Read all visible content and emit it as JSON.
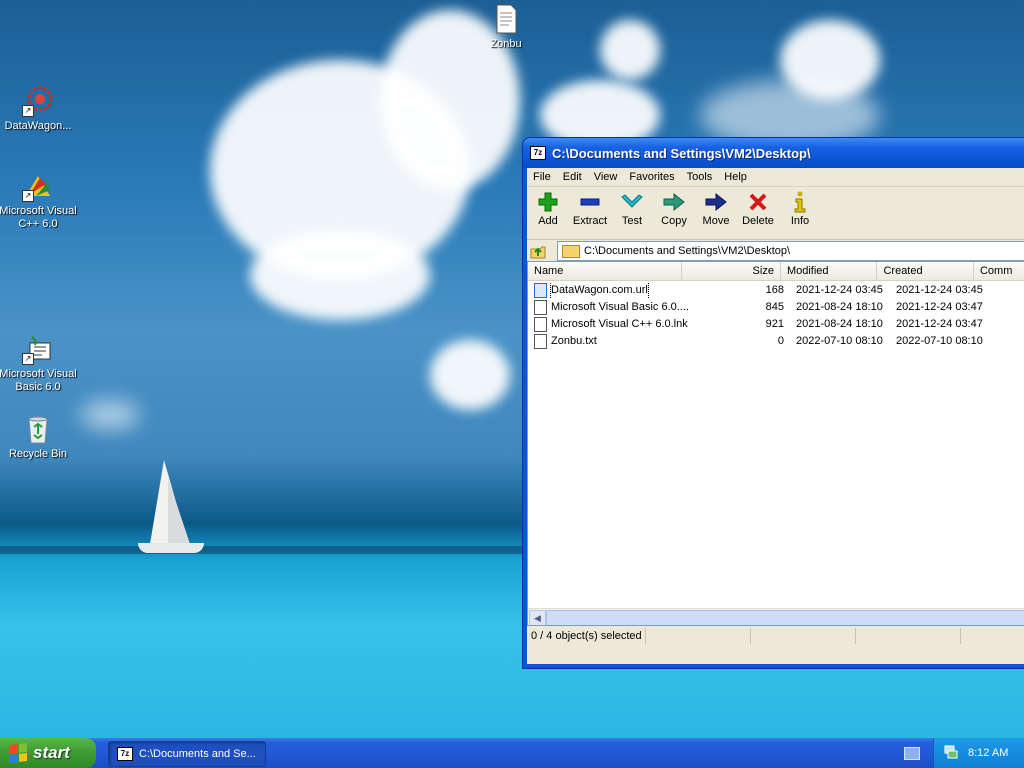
{
  "desktop": {
    "icons": [
      {
        "label": "Zonbu"
      },
      {
        "label": "DataWagon..."
      },
      {
        "label": "Microsoft Visual C++ 6.0"
      },
      {
        "label": "Microsoft Visual Basic 6.0"
      },
      {
        "label": "Recycle Bin"
      }
    ]
  },
  "window": {
    "app_badge": "7z",
    "title": "C:\\Documents and Settings\\VM2\\Desktop\\",
    "menu": [
      "File",
      "Edit",
      "View",
      "Favorites",
      "Tools",
      "Help"
    ],
    "toolbar": [
      {
        "label": "Add",
        "icon": "plus-icon",
        "color": "#1aa31a"
      },
      {
        "label": "Extract",
        "icon": "minus-icon",
        "color": "#1c3fbf"
      },
      {
        "label": "Test",
        "icon": "check-icon",
        "color": "#2bb5c9"
      },
      {
        "label": "Copy",
        "icon": "copy-arrow-icon",
        "color": "#2a9a7a"
      },
      {
        "label": "Move",
        "icon": "move-arrow-icon",
        "color": "#1b2f8f"
      },
      {
        "label": "Delete",
        "icon": "delete-x-icon",
        "color": "#d21a1a"
      },
      {
        "label": "Info",
        "icon": "info-icon",
        "color": "#c9b100"
      }
    ],
    "address": "C:\\Documents and Settings\\VM2\\Desktop\\",
    "columns": [
      "Name",
      "Size",
      "Modified",
      "Created",
      "Comm"
    ],
    "files": [
      {
        "name": "DataWagon.com.url",
        "size": "168",
        "modified": "2021-12-24 03:45",
        "created": "2021-12-24 03:45"
      },
      {
        "name": "Microsoft Visual Basic 6.0....",
        "size": "845",
        "modified": "2021-08-24 18:10",
        "created": "2021-12-24 03:47"
      },
      {
        "name": "Microsoft Visual C++ 6.0.lnk",
        "size": "921",
        "modified": "2021-08-24 18:10",
        "created": "2021-12-24 03:47"
      },
      {
        "name": "Zonbu.txt",
        "size": "0",
        "modified": "2022-07-10 08:10",
        "created": "2022-07-10 08:10"
      }
    ],
    "status": "0 / 4 object(s) selected"
  },
  "taskbar": {
    "start_label": "start",
    "task_label": "C:\\Documents and Se...",
    "task_badge": "7z",
    "clock": "8:12 AM"
  }
}
